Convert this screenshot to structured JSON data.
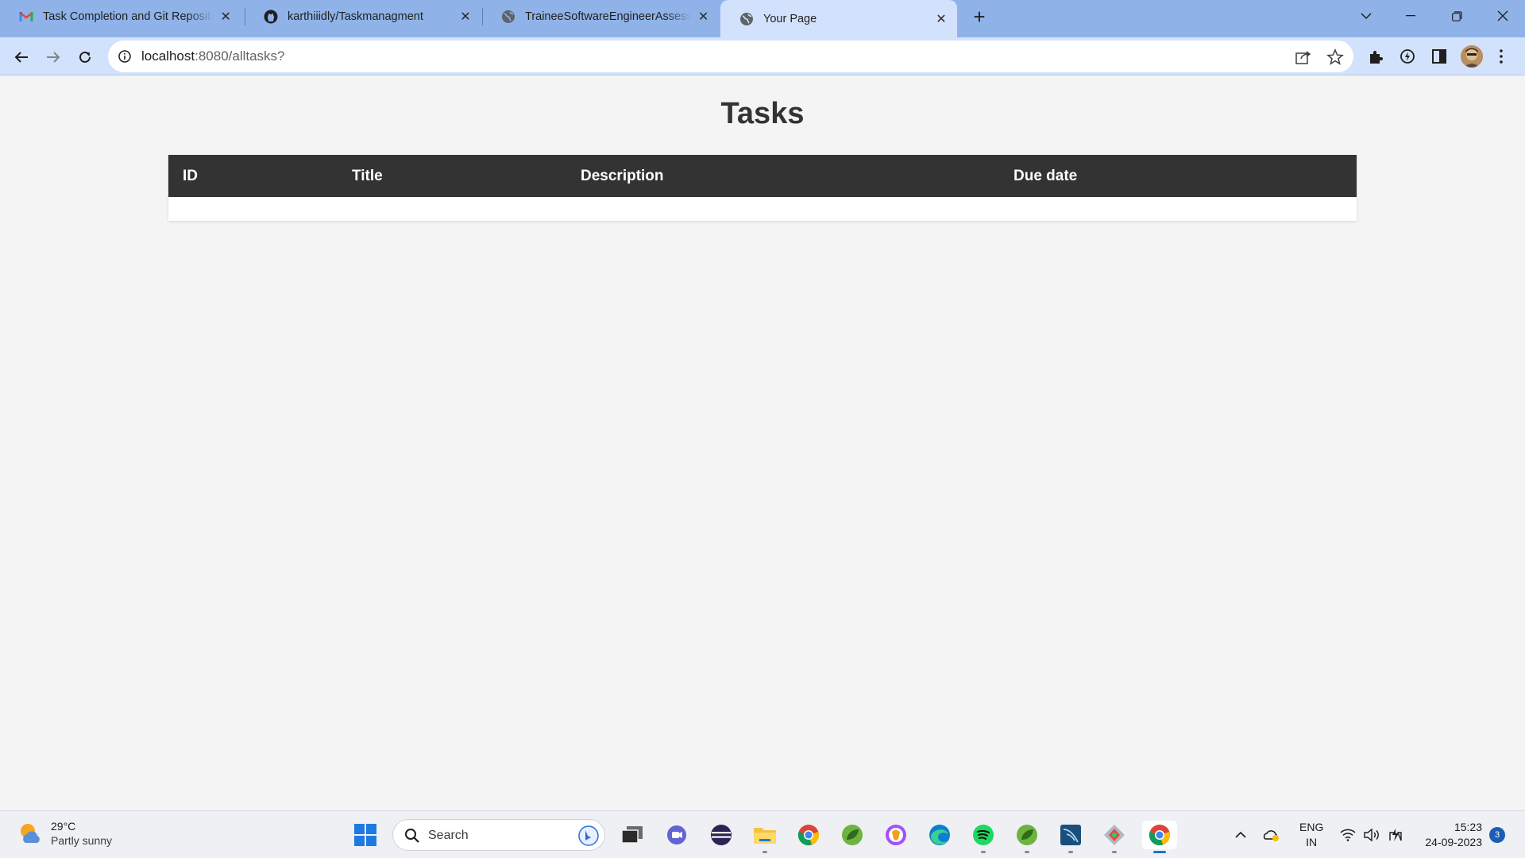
{
  "browser": {
    "tabs": [
      {
        "title": "Task Completion and Git Reposito",
        "favicon": "gmail-icon",
        "active": false
      },
      {
        "title": "karthiiidly/Taskmanagment",
        "favicon": "github-icon",
        "active": false
      },
      {
        "title": "TraineeSoftwareEngineerAssessm",
        "favicon": "globe-icon",
        "active": false
      },
      {
        "title": "Your Page",
        "favicon": "globe-icon",
        "active": true
      }
    ],
    "new_tab_label": "+",
    "address": {
      "host": "localhost",
      "path": ":8080/alltasks?"
    }
  },
  "page": {
    "heading": "Tasks",
    "table": {
      "columns": [
        "ID",
        "Title",
        "Description",
        "Due date"
      ],
      "rows": []
    }
  },
  "taskbar": {
    "weather": {
      "temperature": "29°C",
      "condition": "Partly sunny"
    },
    "search_placeholder": "Search",
    "language": {
      "line1": "ENG",
      "line2": "IN"
    },
    "clock": {
      "time": "15:23",
      "date": "24-09-2023"
    },
    "notification_count": "3"
  },
  "colors": {
    "tab_strip": "#8fb3e8",
    "toolbar": "#d3e2fc",
    "table_header": "#333333",
    "page_bg": "#f4f4f4"
  }
}
